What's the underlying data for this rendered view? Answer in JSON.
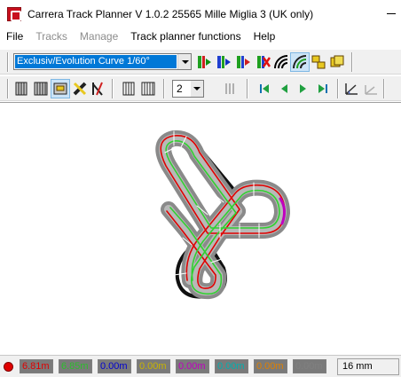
{
  "window": {
    "title": "Carrera Track Planner V 1.0.2 25565 Mille Miglia 3 (UK only)"
  },
  "menu": [
    {
      "label": "File",
      "enabled": true
    },
    {
      "label": "Tracks",
      "enabled": false
    },
    {
      "label": "Manage",
      "enabled": false
    },
    {
      "label": "Track planner functions",
      "enabled": true
    },
    {
      "label": "Help",
      "enabled": true
    }
  ],
  "toolbar1": {
    "track_type_selected": "Exclusiv/Evolution Curve 1/60°",
    "icons": [
      "add-track-green-icon",
      "add-track-blue-icon",
      "add-track-red-icon",
      "remove-track-icon",
      "curve-lanes-icon",
      "curve-lanes-pressed-icon",
      "copy-track-icon",
      "move-track-icon"
    ]
  },
  "toolbar2": {
    "lane_count": "2",
    "icons": [
      "straight-track-icon",
      "double-straight-icon",
      "lap-counter-icon",
      "crossing-icon",
      "lane-change-icon",
      "barrier-icon",
      "double-barrier-icon",
      "first-icon",
      "previous-icon",
      "next-icon",
      "last-icon",
      "measure-icon",
      "measure-disabled-icon"
    ]
  },
  "status": {
    "lengths": [
      {
        "value": "6.81m",
        "color": "#e00000",
        "bg": "#7a7a7a"
      },
      {
        "value": "6.85m",
        "color": "#2bbf2b",
        "bg": "#7a7a7a"
      },
      {
        "value": "0.00m",
        "color": "#0000d0",
        "bg": "#7a7a7a"
      },
      {
        "value": "0.00m",
        "color": "#c8b400",
        "bg": "#7a7a7a"
      },
      {
        "value": "0.00m",
        "color": "#c000c0",
        "bg": "#7a7a7a"
      },
      {
        "value": "0.00m",
        "color": "#00b0b0",
        "bg": "#7a7a7a"
      },
      {
        "value": "0.00m",
        "color": "#e08000",
        "bg": "#7a7a7a"
      },
      {
        "value": "0.00m",
        "color": "#808080",
        "bg": "#7a7a7a"
      }
    ],
    "scale": "16 mm"
  },
  "colors": {
    "track_base": "#8a8a8a",
    "lane_outer": "#e00000",
    "lane_inner": "#30d030",
    "barrier": "#101010",
    "selection": "#c000c0"
  }
}
